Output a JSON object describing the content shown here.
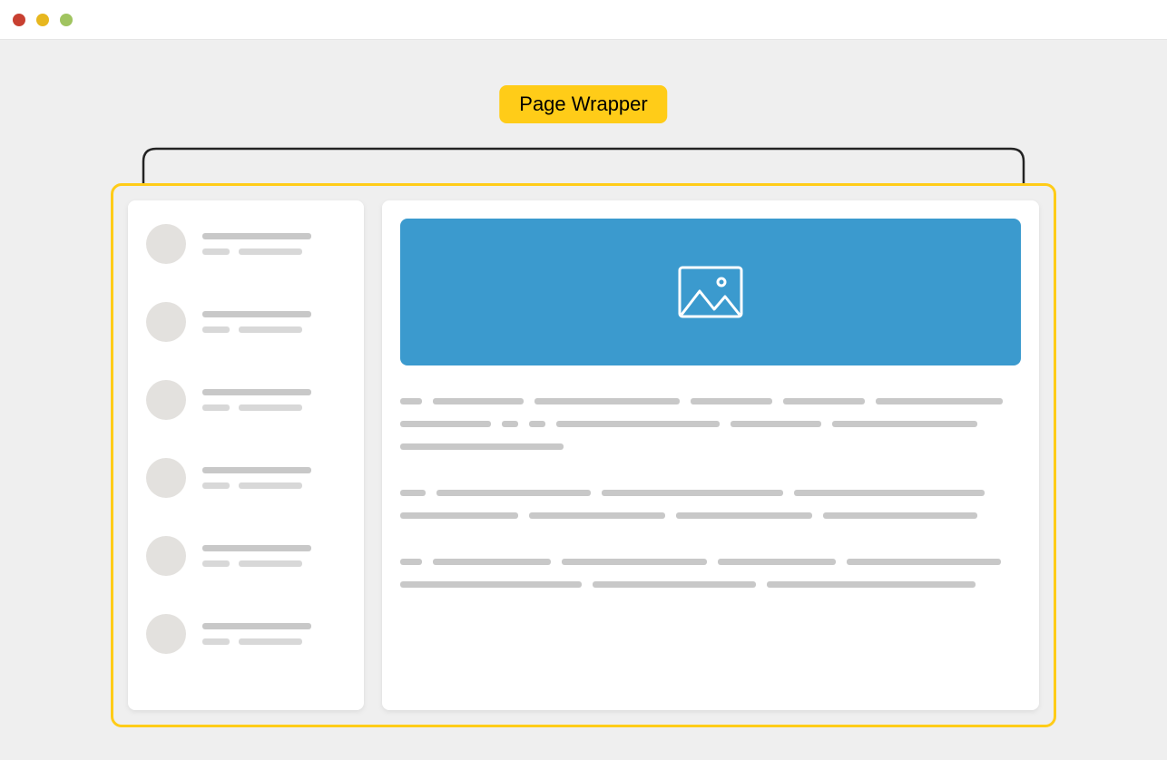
{
  "label": "Page Wrapper",
  "colors": {
    "accent": "#ffcc18",
    "hero": "#3b9ace",
    "placeholder": "#c8c8c8"
  },
  "icon": "image-icon",
  "sidebar_items_count": 6
}
